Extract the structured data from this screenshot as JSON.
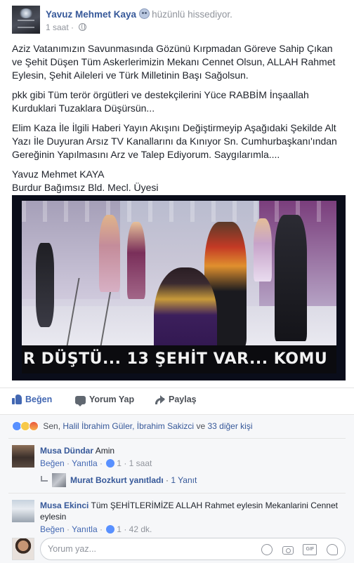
{
  "author": {
    "name": "Yavuz Mehmet Kaya",
    "feeling": "hüzünlü hissediyor.",
    "time": "1 saat",
    "separator": "·"
  },
  "post": {
    "paragraphs": [
      "Aziz Vatanımızın Savunmasında Gözünü Kırpmadan Göreve Sahip Çıkan ve Şehit Düşen Tüm Askerlerimizin Mekanı Cennet Olsun, ALLAH Rahmet Eylesin, Şehit Aileleri ve Türk Milletinin Başı Sağolsun.",
      "pkk gibi Tüm terör örgütleri ve destekçilerini Yüce RABBİM İnşaallah Kurduklari Tuzaklara Düşürsün...",
      "Elim Kaza İle İlgili Haberi Yayın Akışını Değiştirmeyip Aşağıdaki Şekilde Alt Yazı İle Duyuran Arsız TV Kanallarını da Kınıyor Sn. Cumhurbaşkanı'ından Gereğinin Yapılmasını Arz ve Talep Ediyorum. Saygılarımla...."
    ],
    "signature_name": "Yavuz Mehmet KAYA",
    "signature_title": "Burdur Bağımsız Bld. Mecl. Üyesi",
    "image_ticker": "R DÜŞTÜ... 13 ŞEHİT VAR... KOMU"
  },
  "actions": {
    "like": "Beğen",
    "comment": "Yorum Yap",
    "share": "Paylaş"
  },
  "reactions": {
    "you": "Sen,",
    "names": "Halil İbrahim Güler, İbrahim Sakizci",
    "and": "ve",
    "others": "33 diğer kişi"
  },
  "comments": [
    {
      "author": "Musa Dündar",
      "text": "Amin",
      "like_label": "Beğen",
      "reply_label": "Yanıtla",
      "likes": "1",
      "time": "1 saat"
    },
    {
      "author": "Musa Ekinci",
      "text": "Tüm ŞEHİTLERİMİZE ALLAH Rahmet eylesin Mekanlarini Cennet eylesin",
      "like_label": "Beğen",
      "reply_label": "Yanıtla",
      "likes": "1",
      "time": "42 dk."
    }
  ],
  "reply_summary": {
    "author": "Murat Bozkurt yanıtladı",
    "count": "1 Yanıt"
  },
  "composer": {
    "placeholder": "Yorum yaz..."
  },
  "colors": {
    "link_blue": "#365899",
    "like_blue": "#4267b2",
    "meta_gray": "#90949c",
    "comments_bg": "#f6f7f9"
  }
}
